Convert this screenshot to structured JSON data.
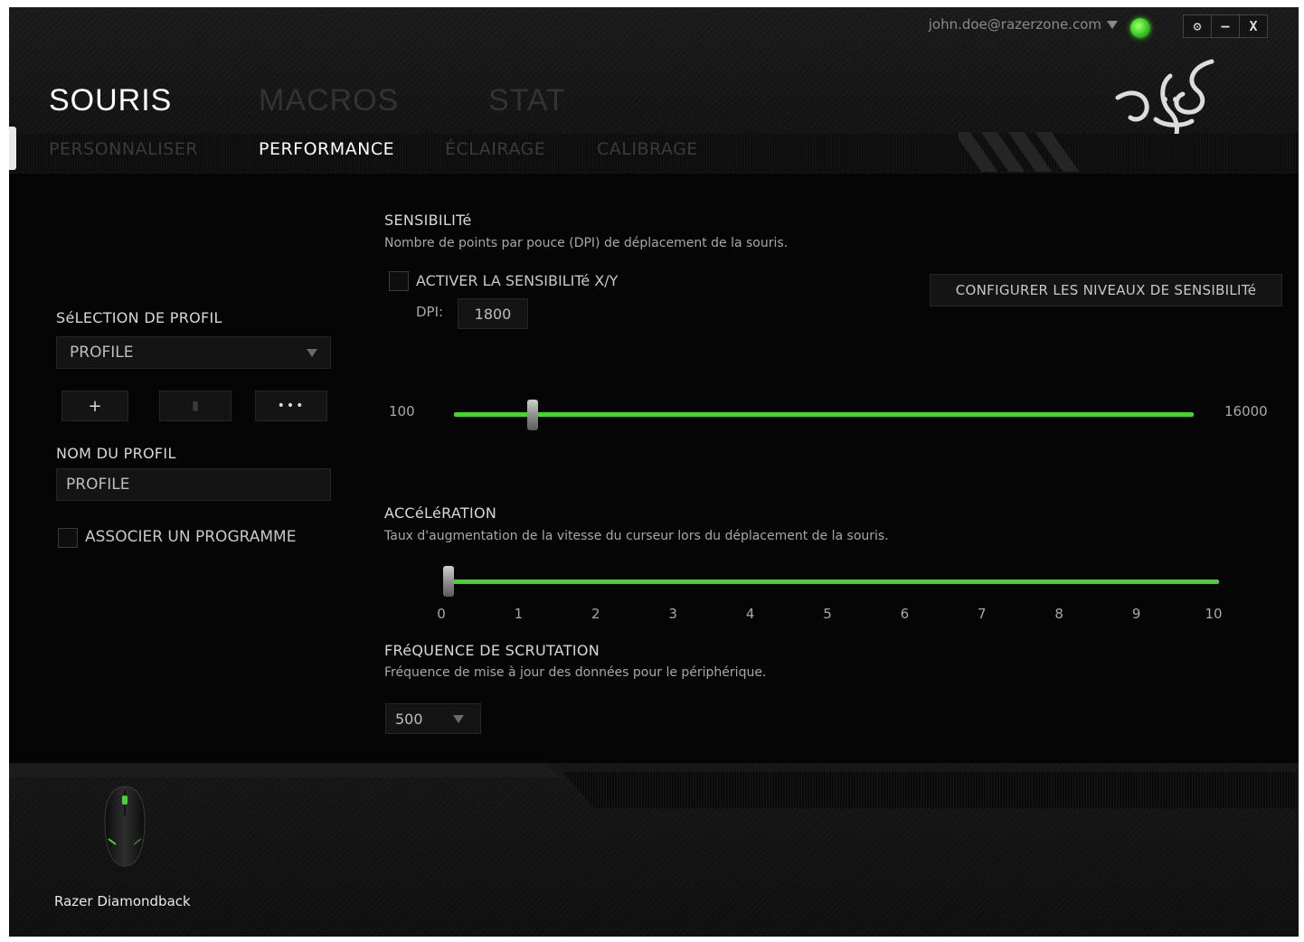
{
  "window": {
    "account": "john.doe@razerzone.com",
    "controls": {
      "settings": "⚙",
      "minimize": "–",
      "close": "X"
    }
  },
  "tabs": {
    "souris": "SOURIS",
    "macros": "MACROS",
    "stat": "STAT"
  },
  "subtabs": {
    "personnaliser": "PERSONNALISER",
    "performance": "PERFORMANCE",
    "eclairage": "ÉCLAIRAGE",
    "calibrage": "CALIBRAGE"
  },
  "profile": {
    "selection_label": "SéLECTION DE PROFIL",
    "selected": "PROFILE",
    "add": "+",
    "delete": "▮",
    "more": "•••",
    "name_label": "NOM DU PROFIL",
    "name_value": "PROFILE",
    "associate_label": "ASSOCIER UN PROGRAMME"
  },
  "sensitivity": {
    "title": "SENSIBILITé",
    "description": "Nombre de points par pouce (DPI) de déplacement de la souris.",
    "xy_label": "ACTIVER LA SENSIBILITé X/Y",
    "dpi_label": "DPI:",
    "dpi_value": "1800",
    "configure_button": "CONFIGURER LES NIVEAUX DE SENSIBILITé",
    "min_label": "100",
    "max_label": "16000",
    "min": 100,
    "max": 16000,
    "value": 1800
  },
  "acceleration": {
    "title": "ACCéLéRATION",
    "description": "Taux d'augmentation de la vitesse du curseur lors du déplacement de la souris.",
    "ticks": [
      "0",
      "1",
      "2",
      "3",
      "4",
      "5",
      "6",
      "7",
      "8",
      "9",
      "10"
    ],
    "value": 0,
    "max": 10
  },
  "polling": {
    "title": "FRéQUENCE DE SCRUTATION",
    "description": "Fréquence de mise à jour des données pour le périphérique.",
    "value": "500"
  },
  "device": {
    "name": "Razer Diamondback"
  },
  "colors": {
    "accent": "#44d62c",
    "background": "#050505"
  }
}
